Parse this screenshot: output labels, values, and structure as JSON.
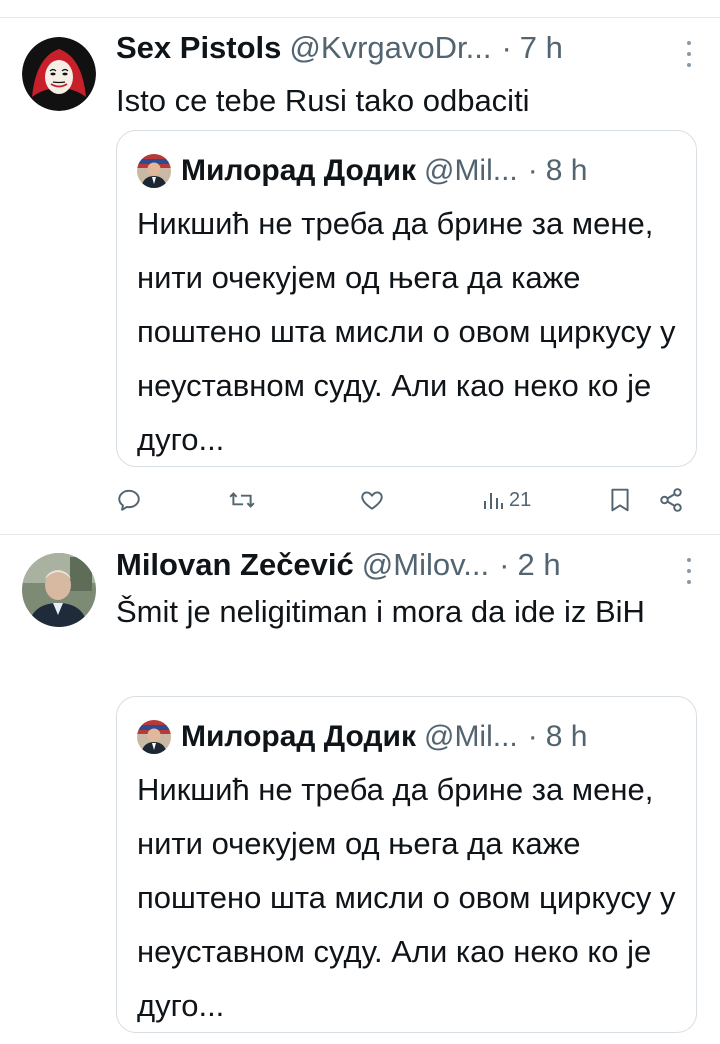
{
  "tweets": [
    {
      "display_name": "Sex Pistols",
      "handle": "@KvrgavoDr...",
      "dot": "·",
      "time": "7 h",
      "avatar_icon": "mask-avatar",
      "text": "Isto ce tebe Rusi tako odbaciti",
      "quote": {
        "display_name": "Милорад Додик",
        "handle": "@Mil...",
        "dot": "·",
        "time": "8 h",
        "avatar_icon": "person-avatar",
        "text": "Никшић не треба да брине за мене, нити очекујем од њега да каже поштено шта мисли о овом циркусу у неуставном суду. Али као неко ко је дуго..."
      },
      "actions": {
        "reply_icon": "reply-icon",
        "retweet_icon": "retweet-icon",
        "like_icon": "heart-icon",
        "views_icon": "views-icon",
        "views_count": "21",
        "bookmark_icon": "bookmark-icon",
        "share_icon": "share-icon"
      }
    },
    {
      "display_name": "Milovan Zečević",
      "handle": "@Milov...",
      "dot": "·",
      "time": "2 h",
      "avatar_icon": "person-avatar",
      "text": "Šmit je neligitiman i mora da ide iz BiH",
      "quote": {
        "display_name": "Милорад Додик",
        "handle": "@Mil...",
        "dot": "·",
        "time": "8 h",
        "avatar_icon": "person-avatar",
        "text": "Никшић не треба да брине за мене, нити очекујем од њега да каже поштено шта мисли о овом циркусу у неуставном суду. Али као неко ко је дуго..."
      }
    }
  ],
  "colors": {
    "text": "#0f1419",
    "secondary": "#536471",
    "border": "#d8dfe4",
    "divider": "#e6e8eb",
    "mask_red": "#c8202a"
  }
}
